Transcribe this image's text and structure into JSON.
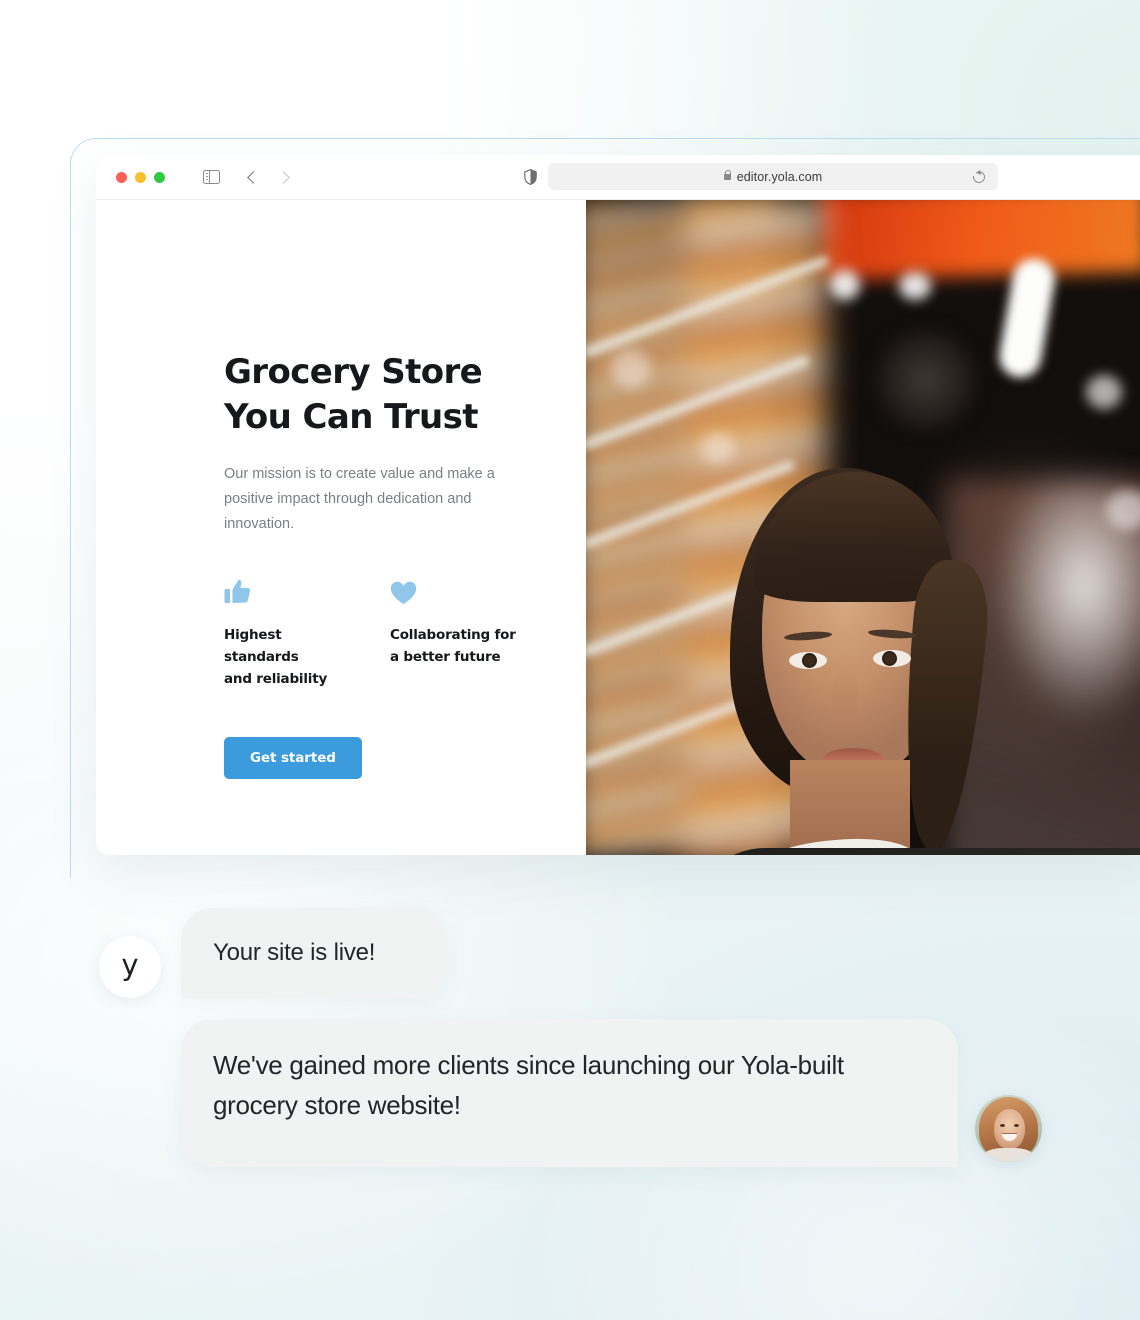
{
  "browser": {
    "url": "editor.yola.com",
    "traffic_lights": [
      "close",
      "minimize",
      "maximize"
    ],
    "icons": {
      "sidebar": "sidebar-toggle-icon",
      "back": "back-chevron-icon",
      "forward": "forward-chevron-icon",
      "shield": "shield-icon",
      "lock": "lock-icon",
      "reload": "reload-icon"
    }
  },
  "site": {
    "hero": {
      "title_line1": "Grocery Store",
      "title_line2": "You Can Trust",
      "subtitle": "Our mission is to create value and make a positive impact through dedication and innovation.",
      "cta_label": "Get started",
      "features": [
        {
          "icon": "thumbs-up-icon",
          "label_line1": "Highest standards",
          "label_line2": "and reliability"
        },
        {
          "icon": "heart-icon",
          "label_line1": "Collaborating for",
          "label_line2": "a better future"
        }
      ]
    },
    "photo_alt": "Woman in a grocery store aisle"
  },
  "chat": {
    "brand_initial": "y",
    "messages": [
      {
        "sender": "yola",
        "text": "Your site is live!"
      },
      {
        "sender": "client",
        "text": "We've gained more clients since launching our Yola-built grocery store website!"
      }
    ],
    "client_avatar_alt": "Smiling woman portrait"
  },
  "colors": {
    "accent_blue": "#3b9bdc",
    "icon_blue": "#8fc6ea",
    "bubble_gray": "#f1f2f2",
    "text_dark": "#16181c",
    "text_muted": "#7b7f85",
    "frame_border": "#bcdcef"
  }
}
